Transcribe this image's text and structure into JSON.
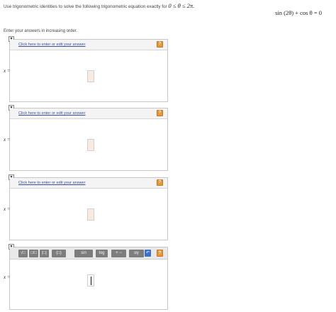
{
  "question": {
    "prompt_text": "Use trigonometric identities to solve the following trigonometric equation exactly for",
    "range": "0 ≤ θ ≤ 2π.",
    "equation": "sin (2θ) + cos θ = 0",
    "instruction": "Enter your answers in increasing order."
  },
  "answers": [
    {
      "collapse_symbol": "▾",
      "link_text": "Click here to enter or edit your answer",
      "help_symbol": "?",
      "var_label": "x ="
    },
    {
      "collapse_symbol": "▾",
      "link_text": "Click here to enter or edit your answer",
      "help_symbol": "?",
      "var_label": "x ="
    },
    {
      "collapse_symbol": "▾",
      "link_text": "Click here to enter or edit your answer",
      "help_symbol": "?",
      "var_label": "x ="
    }
  ],
  "active_answer": {
    "collapse_symbol": "▾",
    "var_label": "x =",
    "toolbar": {
      "sqrt": "√□",
      "frac": "□/□",
      "abs": "|□|",
      "paren": "(□)",
      "sin": "sin",
      "log": "log",
      "ops": "+ −",
      "greek": "αγ",
      "undo": "↶",
      "help": "?"
    }
  },
  "colors": {
    "link": "#3c4f9c",
    "help_button": "#e9963a",
    "undo_button": "#3b71c6",
    "toolbar_button": "#7d7d7d",
    "placeholder": "#f8e9e1"
  }
}
